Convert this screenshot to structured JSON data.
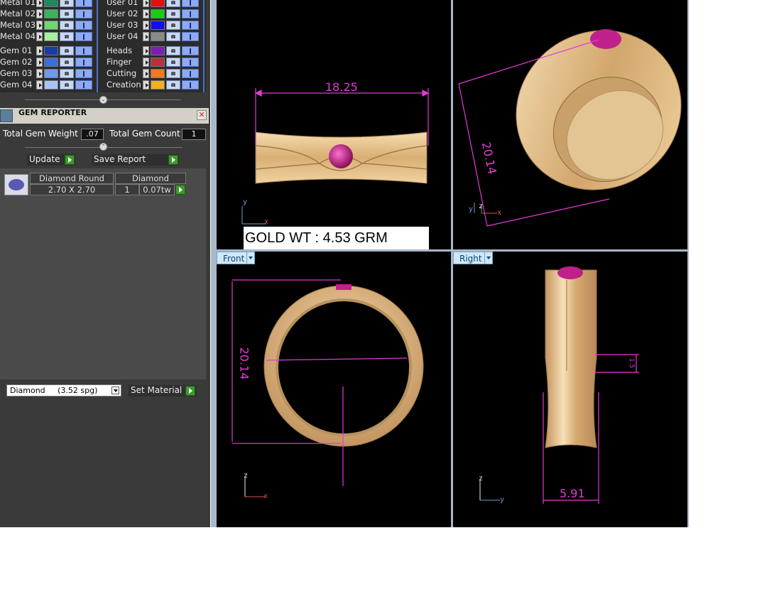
{
  "layers": {
    "metal": [
      {
        "label": "Metal 01",
        "color": "#1f8a5a"
      },
      {
        "label": "Metal 02",
        "color": "#3cb35a"
      },
      {
        "label": "Metal 03",
        "color": "#6ed86e"
      },
      {
        "label": "Metal 04",
        "color": "#a6f0a0"
      }
    ],
    "user": [
      {
        "label": "User 01",
        "color": "#e01010"
      },
      {
        "label": "User 02",
        "color": "#10d010"
      },
      {
        "label": "User 03",
        "color": "#1010e0"
      },
      {
        "label": "User 04",
        "color": "#8a8a8a"
      }
    ],
    "gem": [
      {
        "label": "Gem 01",
        "color": "#1a3ca8"
      },
      {
        "label": "Gem 02",
        "color": "#3a6fd8"
      },
      {
        "label": "Gem 03",
        "color": "#6e9af0"
      },
      {
        "label": "Gem 04",
        "color": "#a8c4f8"
      }
    ],
    "other": [
      {
        "label": "Heads",
        "color": "#7a1fb0"
      },
      {
        "label": "Finger",
        "color": "#b8303a"
      },
      {
        "label": "Cutting",
        "color": "#f07a1a"
      },
      {
        "label": "Creation",
        "color": "#f0b020"
      }
    ]
  },
  "gem_reporter": {
    "title": "GEM REPORTER",
    "close_glyph": "✕",
    "total_weight_label": "Total Gem Weight",
    "total_weight_value": ".07",
    "total_count_label": "Total Gem Count",
    "total_count_value": "1",
    "update_label": "Update",
    "save_report_label": "Save Report",
    "table": {
      "header_shape": "Diamond Round",
      "header_material": "Diamond",
      "size": "2.70 X 2.70",
      "count": "1",
      "weight": "0.07tw"
    },
    "material_select": "Diamond     (3.52 spg)",
    "set_material_label": "Set Material"
  },
  "viewports": {
    "top_left": {
      "dimension": "18.25",
      "axis_y": "y",
      "axis_x": "x"
    },
    "top_right": {
      "dimension": "20.14",
      "axis_y": "y",
      "axis_z": "z",
      "axis_x": "x"
    },
    "front": {
      "label": "Front",
      "dimension": "20.14",
      "axis_z": "z",
      "axis_x": "x"
    },
    "right": {
      "label": "Right",
      "dimension": "5.91",
      "small_dim": "1.5",
      "axis_z": "z",
      "axis_y": "y"
    }
  },
  "gold_weight": "GOLD WT : 4.53 GRM",
  "colors": {
    "dimension": "#e23bd6",
    "gold_light": "#f3d7a4",
    "gold_mid": "#d9b07a",
    "gold_dark": "#8a6a3e",
    "gem": "#c0208a"
  }
}
